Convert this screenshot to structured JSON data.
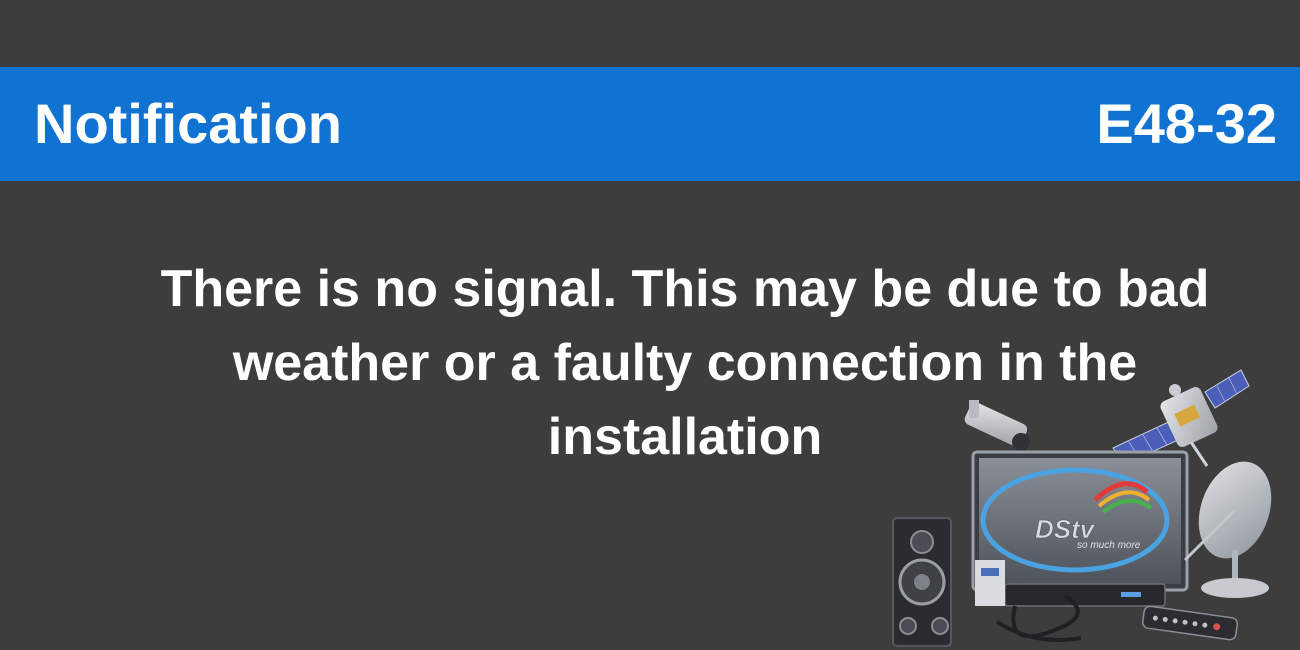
{
  "header": {
    "title": "Notification",
    "error_code": "E48-32"
  },
  "body": {
    "message": "There is no signal. This may be due to bad weather or a faulty connection in the installation"
  },
  "illustration": {
    "brand": "DStv",
    "tagline": "so much more",
    "items": [
      "satellite-icon",
      "cctv-camera-icon",
      "tv-icon",
      "satellite-dish-icon",
      "speaker-icon",
      "decoder-icon",
      "remote-control-icon",
      "cable-icon"
    ]
  },
  "colors": {
    "background": "#3d3d3d",
    "banner": "#1173d1",
    "text": "#ffffff"
  }
}
